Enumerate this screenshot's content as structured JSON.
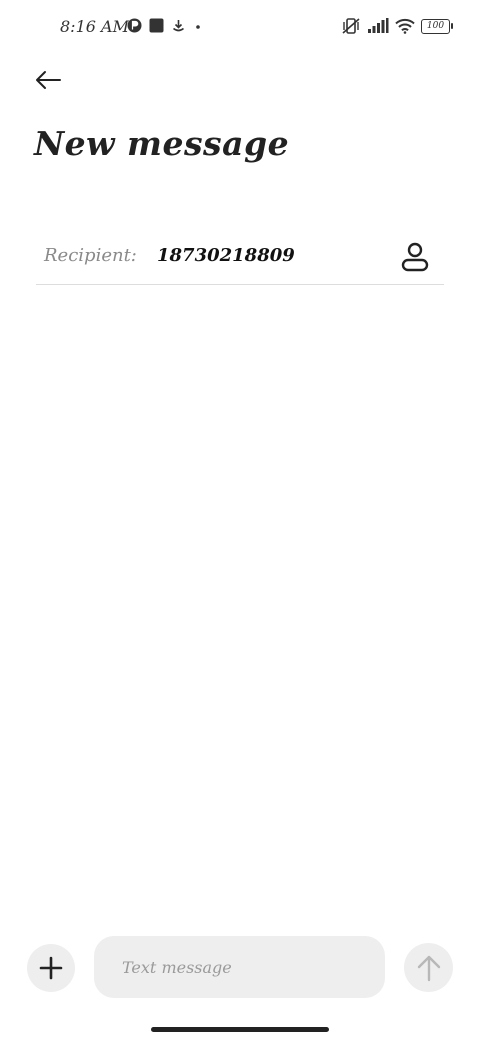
{
  "status_bar": {
    "time": "8:16 AM",
    "battery": "100"
  },
  "header": {
    "title": "New message"
  },
  "recipient": {
    "label": "Recipient:",
    "value": "18730218809"
  },
  "composer": {
    "placeholder": "Text message",
    "value": ""
  },
  "colors": {
    "background": "#ffffff",
    "text": "#222222",
    "muted": "#8a8a8a",
    "control_bg": "#eeeeee",
    "divider": "#dddddd"
  }
}
